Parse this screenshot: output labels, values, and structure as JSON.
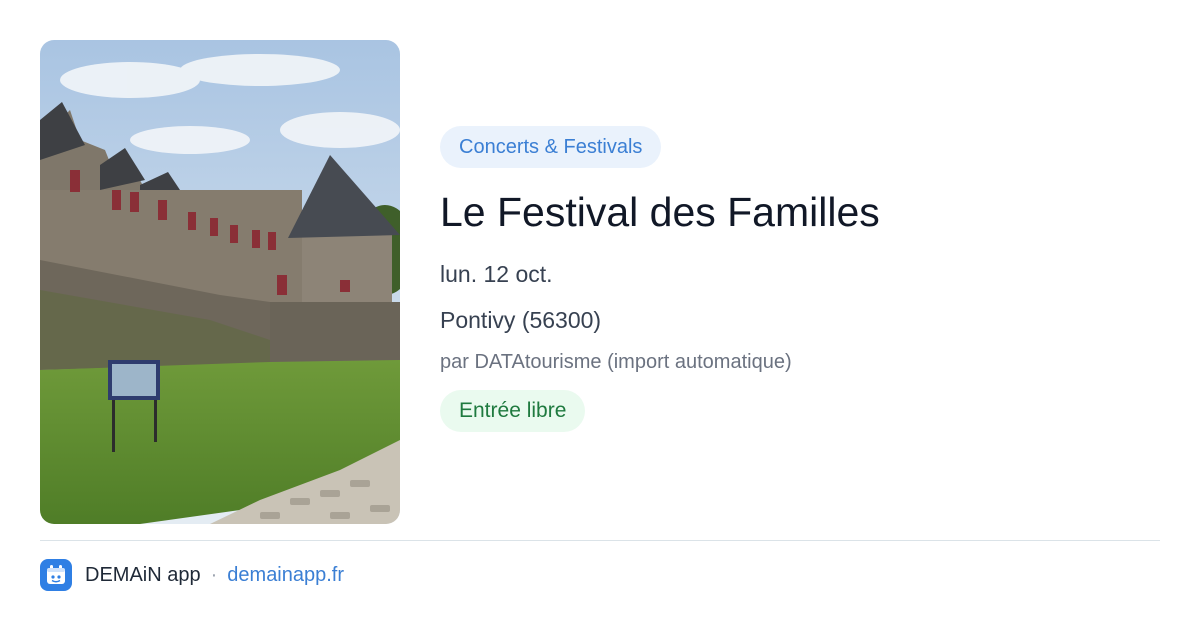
{
  "event": {
    "category": "Concerts & Festivals",
    "title": "Le Festival des Familles",
    "date": "lun. 12 oct.",
    "location": "Pontivy (56300)",
    "source": "par DATAtourisme (import automatique)",
    "price": "Entrée libre"
  },
  "footer": {
    "app_name": "DEMAiN app",
    "separator": "·",
    "link_text": "demainapp.fr",
    "logo_icon": "demain-calendar-icon"
  },
  "colors": {
    "category_bg": "#eaf2fc",
    "category_text": "#3b7fd4",
    "price_bg": "#eafaef",
    "price_text": "#1f7a3f",
    "brand": "#2f7fe4"
  }
}
